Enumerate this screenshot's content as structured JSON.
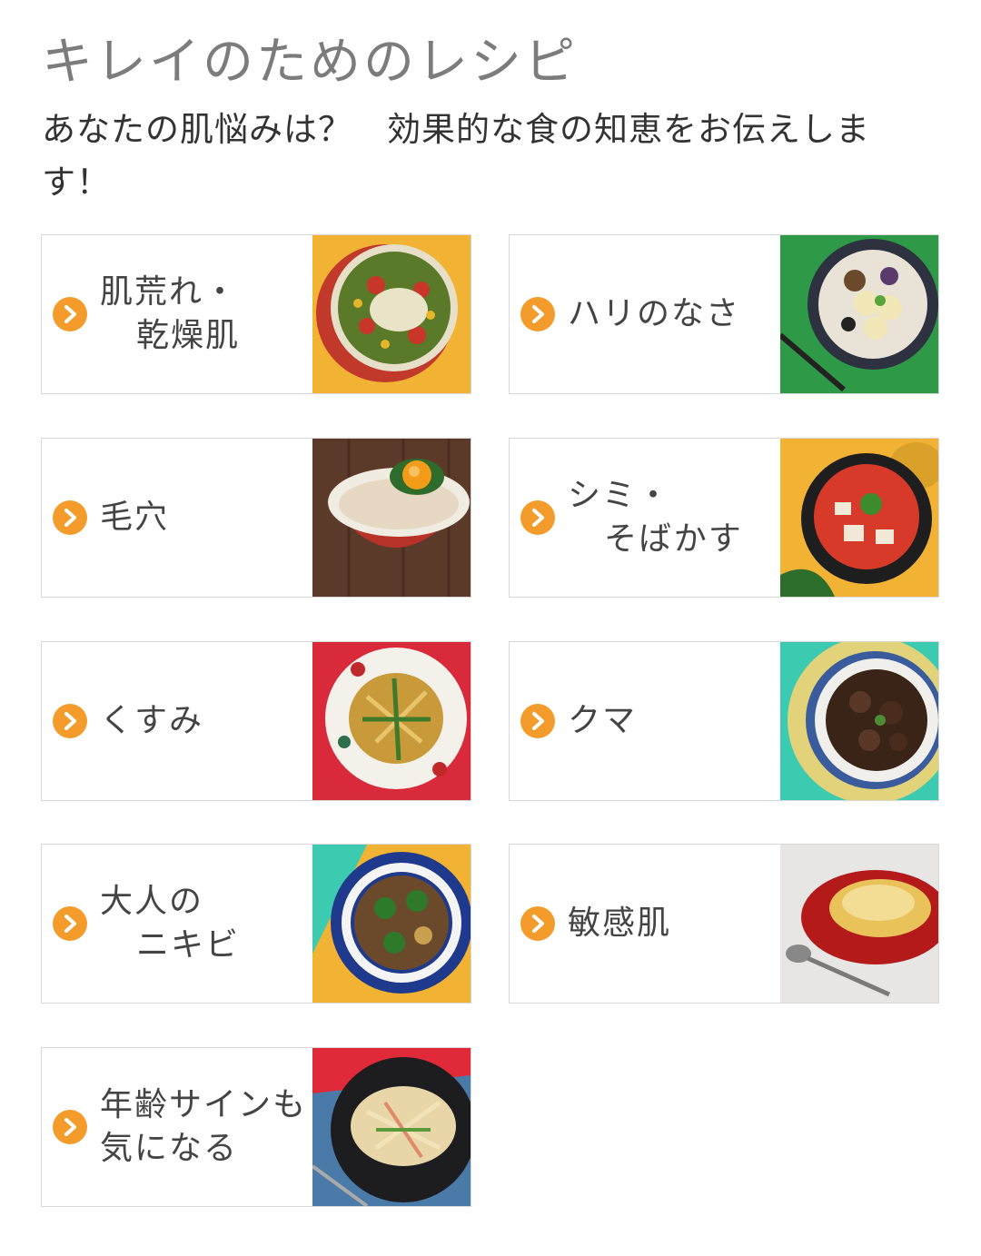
{
  "page": {
    "title": "キレイのためのレシピ",
    "subtitle": "あなたの肌悩みは？　効果的な食の知恵をお伝えします！"
  },
  "colors": {
    "accent": "#f39c2b",
    "title_gray": "#7c7c7c"
  },
  "icons": {
    "card_arrow": "chevron-right-circle-icon"
  },
  "categories": [
    {
      "line1": "肌荒れ・",
      "line2": "乾燥肌",
      "image": "food-photo-veggie-bowl"
    },
    {
      "line1": "ハリのなさ",
      "line2": "",
      "image": "food-photo-banana-granola-bowl"
    },
    {
      "line1": "毛穴",
      "line2": "",
      "image": "food-photo-chicken-egg-bowl"
    },
    {
      "line1": "シミ・",
      "line2": "そばかす",
      "image": "food-photo-tomato-stew-pot"
    },
    {
      "line1": "くすみ",
      "line2": "",
      "image": "food-photo-stir-fried-noodles"
    },
    {
      "line1": "クマ",
      "line2": "",
      "image": "food-photo-braised-mushrooms"
    },
    {
      "line1": "大人の",
      "line2": "ニキビ",
      "image": "food-photo-broccoli-stir-fry"
    },
    {
      "line1": "敏感肌",
      "line2": "",
      "image": "food-photo-gratin"
    },
    {
      "line1": "年齢サインも",
      "line2": "気になる",
      "image": "food-photo-radish-salad"
    }
  ]
}
